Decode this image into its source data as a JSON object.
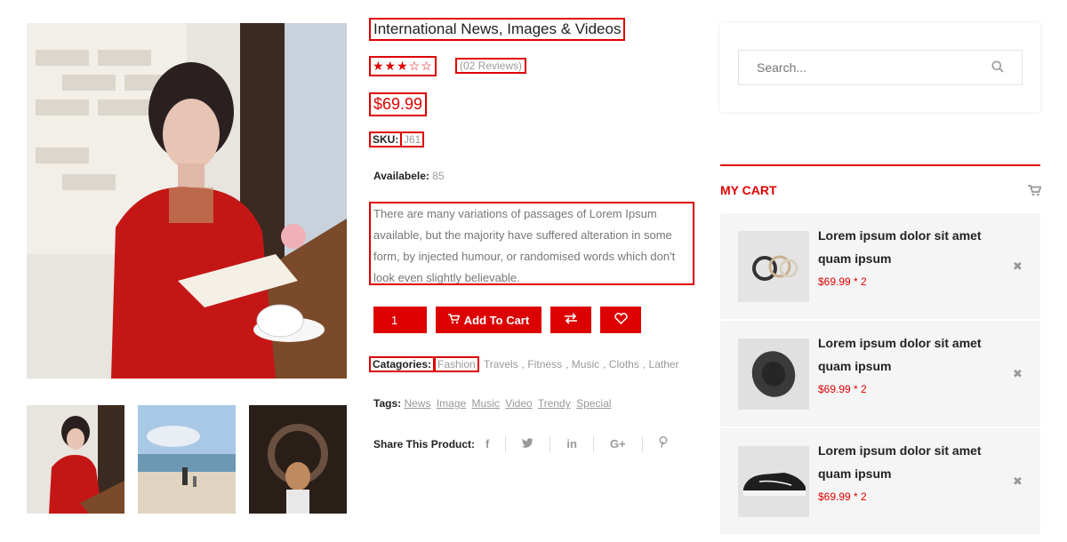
{
  "product": {
    "title": "International News, Images & Videos",
    "stars": "★★★☆☆",
    "reviews": "(02 Reviews)",
    "price": "$69.99",
    "sku_label": "SKU:",
    "sku_value": "J61",
    "available_label": "Availabele:",
    "available_value": "85",
    "description": "There are many variations of passages of Lorem Ipsum available, but the majority have suffered alteration in some form, by injected humour, or randomised words which don't look even slightly believable.",
    "quantity": "1",
    "add_to_cart_label": "Add To Cart",
    "categories_label": "Catagories:",
    "categories": [
      "Fashion",
      "Travels",
      "Fitness",
      "Music",
      "Cloths",
      "Lather"
    ],
    "tags_label": "Tags:",
    "tags": [
      "News",
      "Image",
      "Music",
      "Video",
      "Trendy",
      "Special"
    ],
    "share_label": "Share This Product:",
    "social_icons": [
      "facebook-icon",
      "twitter-icon",
      "linkedin-icon",
      "google-plus-icon",
      "pinterest-icon"
    ]
  },
  "sidebar": {
    "search_placeholder": "Search...",
    "cart_title": "MY CART",
    "cart_items": [
      {
        "name": "Lorem ipsum dolor sit amet quam ipsum",
        "price": "$69.99 * 2",
        "image": "rings-image"
      },
      {
        "name": "Lorem ipsum dolor sit amet quam ipsum",
        "price": "$69.99 * 2",
        "image": "hat-image"
      },
      {
        "name": "Lorem ipsum dolor sit amet quam ipsum",
        "price": "$69.99 * 2",
        "image": "sneaker-image"
      }
    ]
  },
  "colors": {
    "accent": "#dd0000",
    "muted": "#999999",
    "panel": "#f5f5f5"
  }
}
